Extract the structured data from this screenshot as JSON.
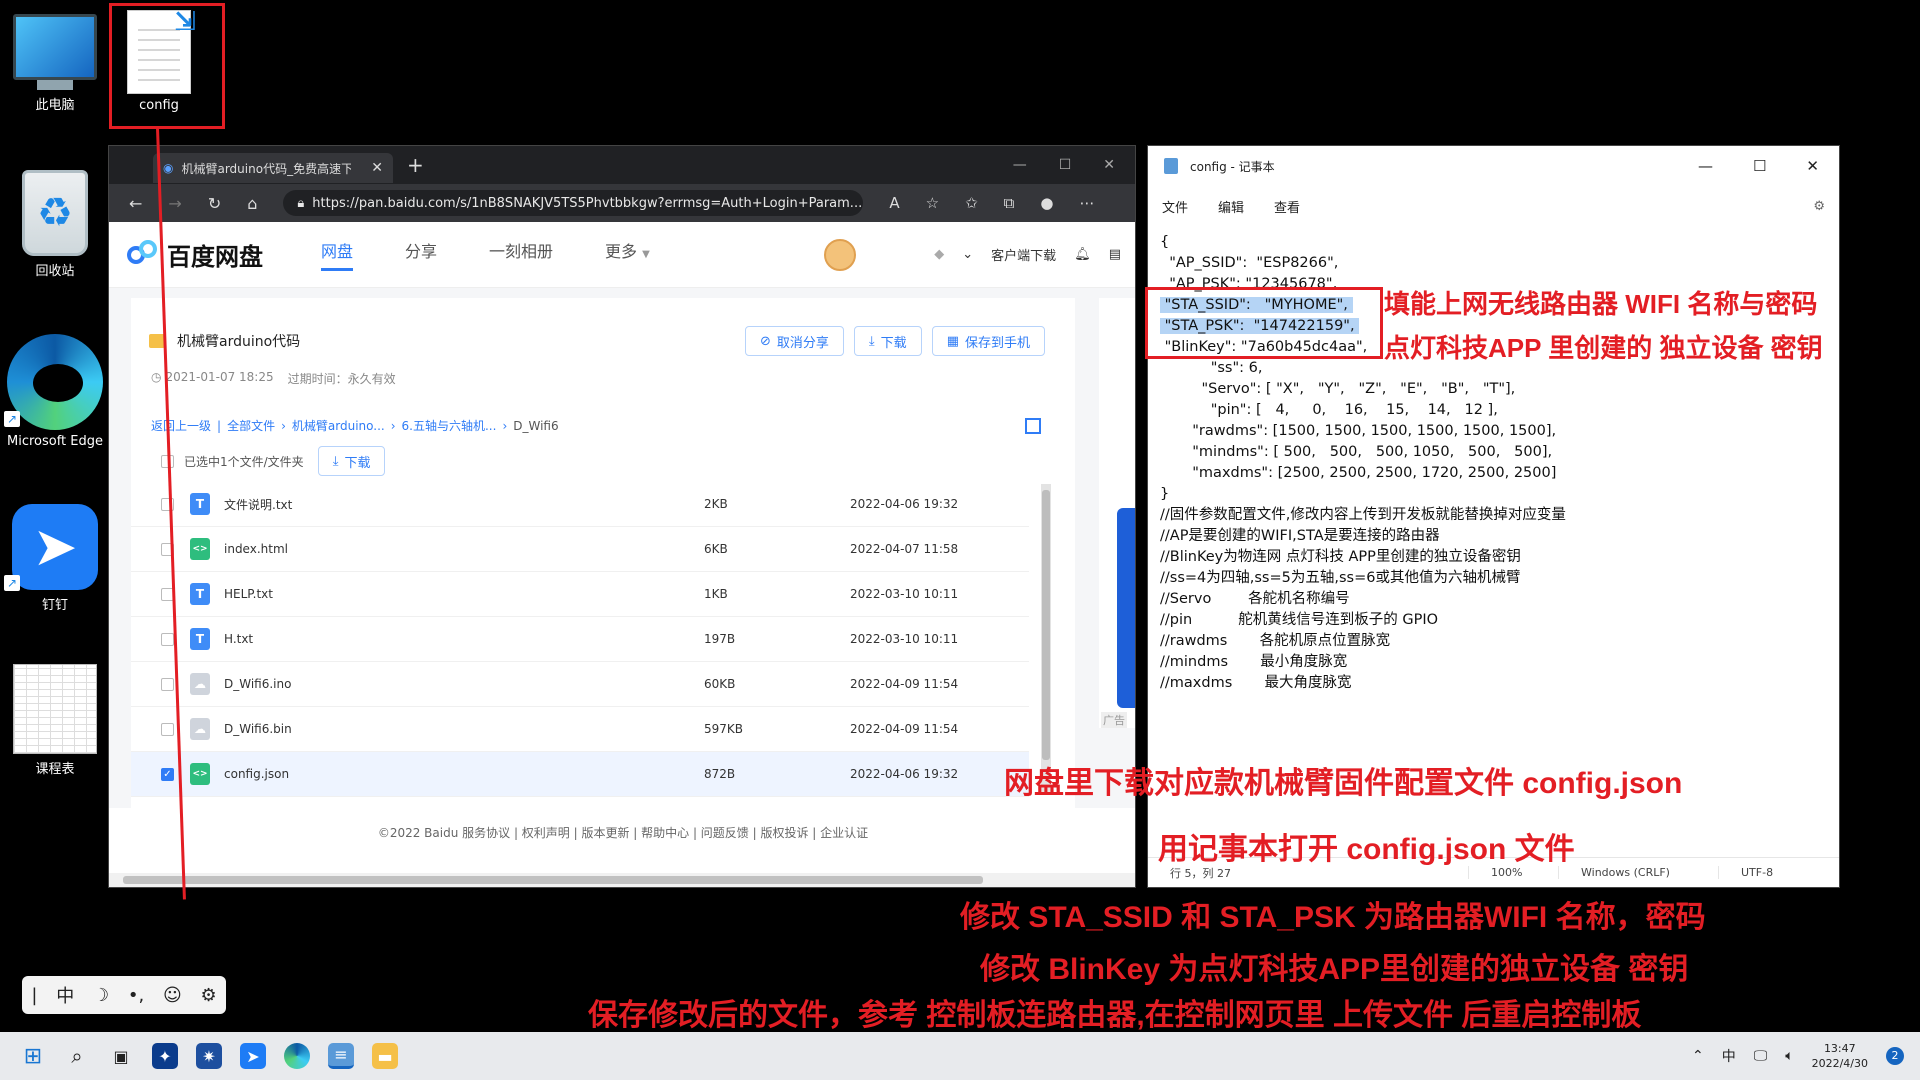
{
  "desktop": {
    "icons": [
      {
        "label": "此电脑",
        "icon": "computer-icon"
      },
      {
        "label": "config",
        "icon": "text-file-icon"
      },
      {
        "label": "回收站",
        "icon": "recycle-bin-icon"
      },
      {
        "label": "Microsoft Edge",
        "icon": "edge-icon"
      },
      {
        "label": "钉钉",
        "icon": "dingtalk-icon"
      },
      {
        "label": "课程表",
        "icon": "spreadsheet-icon"
      }
    ]
  },
  "browser": {
    "tab_title": "机械臂arduino代码_免费高速下载",
    "url": "https://pan.baidu.com/s/1nB8SNAKJV5TS5Phvtbbkgw?errmsg=Auth+Login+Param...",
    "brand": "百度网盘",
    "nav": [
      "网盘",
      "分享",
      "一刻相册",
      "更多"
    ],
    "client_download": "客户端下载",
    "folder_title": "机械臂arduino代码",
    "buttons": {
      "cancel_share": "取消分享",
      "download": "下载",
      "save_phone": "保存到手机"
    },
    "meta_date": "2021-01-07 18:25",
    "meta_expire": "过期时间：永久有效",
    "breadcrumbs": [
      "返回上一级",
      "全部文件",
      "机械臂arduino...",
      "6.五轴与六轴机...",
      "D_Wifi6"
    ],
    "selected_text": "已选中1个文件/文件夹",
    "selected_download": "下载",
    "files": [
      {
        "name": "文件说明.txt",
        "size": "2KB",
        "date": "2022-04-06 19:32",
        "type": "t",
        "checked": false
      },
      {
        "name": "index.html",
        "size": "6KB",
        "date": "2022-04-07 11:58",
        "type": "h",
        "checked": false
      },
      {
        "name": "HELP.txt",
        "size": "1KB",
        "date": "2022-03-10 10:11",
        "type": "t",
        "checked": false
      },
      {
        "name": "H.txt",
        "size": "197B",
        "date": "2022-03-10 10:11",
        "type": "t",
        "checked": false
      },
      {
        "name": "D_Wifi6.ino",
        "size": "60KB",
        "date": "2022-04-09 11:54",
        "type": "b",
        "checked": false
      },
      {
        "name": "D_Wifi6.bin",
        "size": "597KB",
        "date": "2022-04-09 11:54",
        "type": "b",
        "checked": false
      },
      {
        "name": "config.json",
        "size": "872B",
        "date": "2022-04-06 19:32",
        "type": "h",
        "checked": true
      }
    ],
    "footer": "©2022 Baidu  服务协议 | 权利声明 | 版本更新 | 帮助中心 | 问题反馈 | 版权投诉 | 企业认证",
    "ad_label": "广告"
  },
  "notepad": {
    "title": "config - 记事本",
    "menu": [
      "文件",
      "编辑",
      "查看"
    ],
    "lines_before": "{\n  \"AP_SSID\":  \"ESP8266\",\n  \"AP_PSK\": \"12345678\",",
    "line_ssid": " \"STA_SSID\":   \"MYHOME\", ",
    "line_psk": " \"STA_PSK\":  \"147422159\", ",
    "line_blinkey": " \"BlinKey\": \"7a60b45dc4aa\",",
    "lines_after": "           \"ss\": 6,\n         \"Servo\": [ \"X\",   \"Y\",   \"Z\",   \"E\",   \"B\",   \"T\"],\n           \"pin\": [   4,     0,    16,    15,    14,   12 ],\n       \"rawdms\": [1500, 1500, 1500, 1500, 1500, 1500],\n       \"mindms\": [ 500,   500,   500, 1050,   500,   500],\n       \"maxdms\": [2500, 2500, 2500, 1720, 2500, 2500]\n}\n//固件参数配置文件,修改内容上传到开发板就能替换掉对应变量\n//AP是要创建的WIFI,STA是要连接的路由器\n//BlinKey为物连网 点灯科技 APP里创建的独立设备密钥\n//ss=4为四轴,ss=5为五轴,ss=6或其他值为六轴机械臂\n//Servo        各舵机名称编号\n//pin          舵机黄线信号连到板子的 GPIO\n//rawdms       各舵机原点位置脉宽\n//mindms       最小角度脉宽\n//maxdms       最大角度脉宽",
    "status": {
      "pos": "行 5，列 27",
      "zoom": "100%",
      "eol": "Windows (CRLF)",
      "enc": "UTF-8"
    }
  },
  "annotations": {
    "wifi": "填能上网无线路由器 WIFI 名称与密码",
    "blinkey": "点灯科技APP 里创建的 独立设备 密钥",
    "download": "网盘里下载对应款机械臂固件配置文件 config.json",
    "open": "用记事本打开 config.json 文件",
    "step1": "修改 STA_SSID 和 STA_PSK 为路由器WIFI 名称，密码",
    "step2": "修改 BlinKey 为点灯科技APP里创建的独立设备 密钥",
    "step3": "保存修改后的文件，参考 控制板连路由器,在控制网页里 上传文件  后重启控制板"
  },
  "ime": [
    "|",
    "中",
    "☽",
    "•,",
    "☺",
    "⚙"
  ],
  "taskbar": {
    "input_lang": "中",
    "time": "13:47",
    "date": "2022/4/30",
    "notifications": "2"
  },
  "colors": {
    "annotation": "#e31e24",
    "baidu_blue": "#2f7cf6",
    "highlight": "#b5d4f5"
  }
}
